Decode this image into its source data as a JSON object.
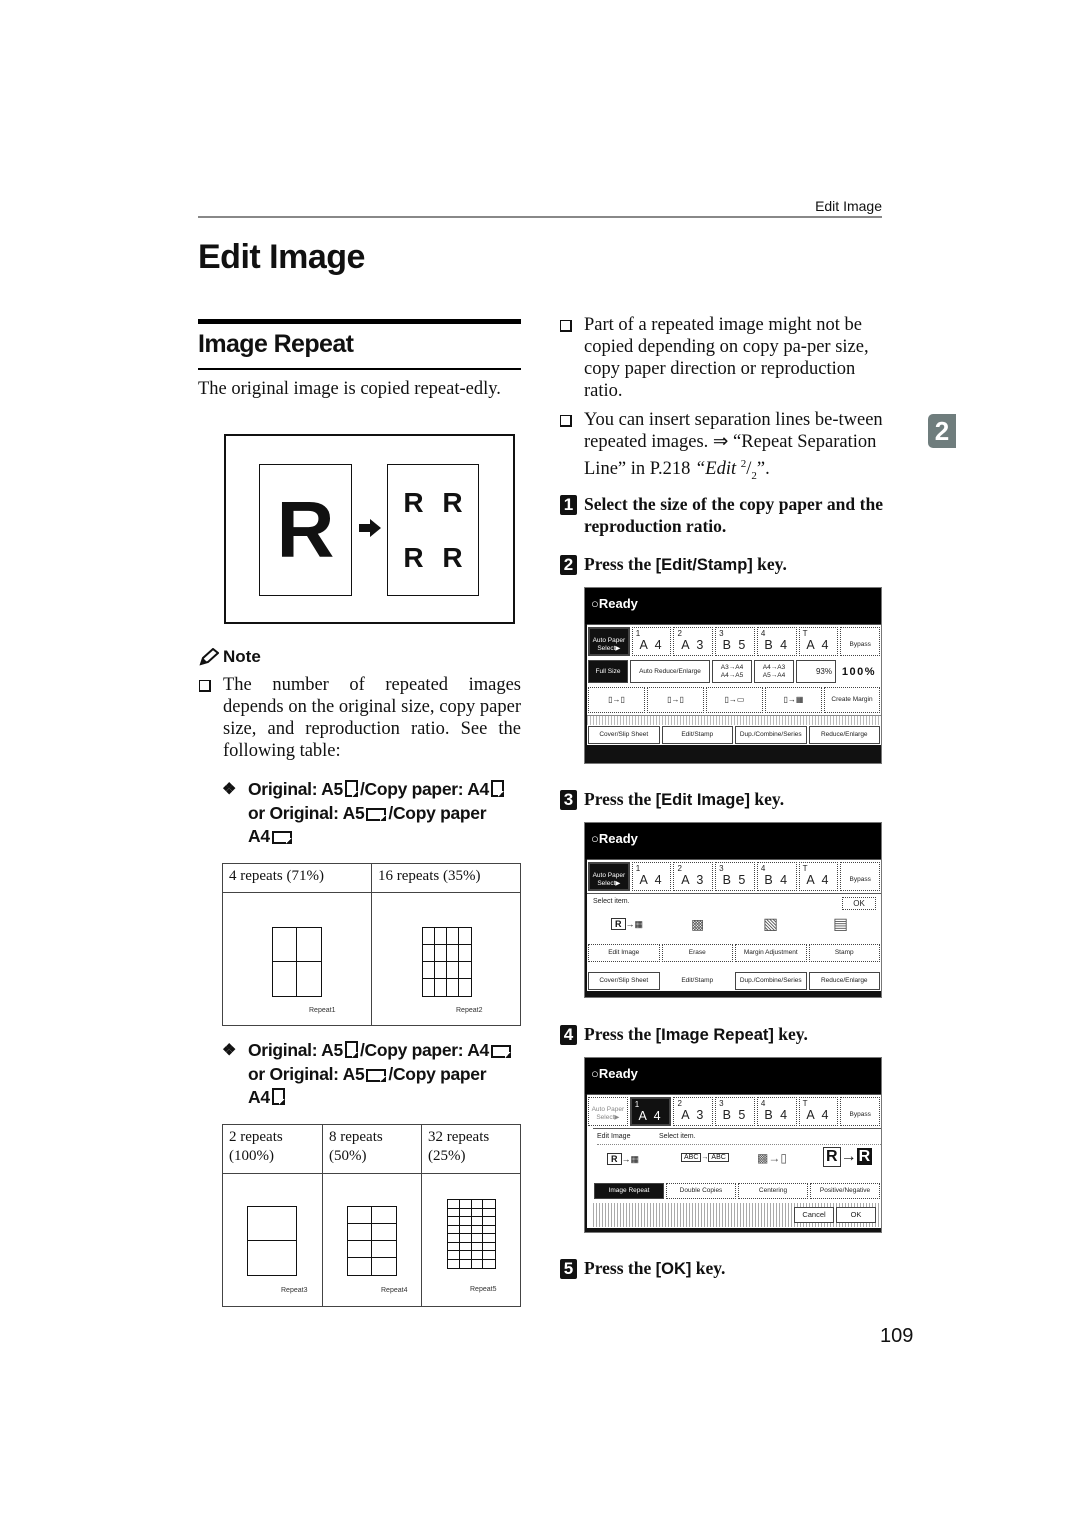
{
  "header": {
    "running_head": "Edit Image",
    "page_title": "Edit Image",
    "chapter_tab": "2",
    "page_number": "109"
  },
  "section": {
    "title": "Image Repeat",
    "intro": "The original image is copied repeat-edly.",
    "illustration": {
      "original_letter": "R",
      "copy_letters": [
        "R",
        "R",
        "R",
        "R"
      ]
    },
    "note": {
      "heading": "Note",
      "item": "The number of repeated images depends on the original size, copy paper size, and reproduction ratio. See the following table:"
    },
    "case1": {
      "heading_parts": [
        "Original: A5",
        "/Copy paper: A4",
        "or Original: A5",
        "/Copy paper",
        "A4"
      ],
      "columns": [
        {
          "label": "4 repeats (71%)",
          "figure_label": "Repeat1",
          "grid_cols": 2,
          "grid_rows": 2
        },
        {
          "label": "16 repeats (35%)",
          "figure_label": "Repeat2",
          "grid_cols": 4,
          "grid_rows": 4
        }
      ]
    },
    "case2": {
      "heading_parts": [
        "Original: A5",
        "/Copy paper: A4",
        "or Original: A5",
        "/Copy paper",
        "A4"
      ],
      "columns": [
        {
          "label_line1": "2 repeats",
          "label_line2": "(100%)",
          "figure_label": "Repeat3",
          "grid_cols": 1,
          "grid_rows": 2
        },
        {
          "label_line1": "8 repeats",
          "label_line2": "(50%)",
          "figure_label": "Repeat4",
          "grid_cols": 2,
          "grid_rows": 4
        },
        {
          "label_line1": "32 repeats",
          "label_line2": "(25%)",
          "figure_label": "Repeat5",
          "grid_cols": 4,
          "grid_rows": 8
        }
      ]
    }
  },
  "right": {
    "bullets": [
      "Part of a repeated image might not be copied depending on copy pa-per size, copy paper direction or reproduction ratio.",
      "You can insert separation lines be-tween repeated images. ⇒ “Repeat Separation Line” in P.218 "
    ],
    "bullet2_ref": "“Edit ",
    "bullet2_sup": "2",
    "bullet2_sub": "2",
    "bullet2_end": "”.",
    "steps": [
      {
        "num": "1",
        "text": "Select the size of the copy paper and the reproduction ratio."
      },
      {
        "num": "2",
        "pre": "Press the ",
        "key": "[Edit/Stamp]",
        "post": " key."
      },
      {
        "num": "3",
        "pre": "Press the ",
        "key": "[Edit Image]",
        "post": " key."
      },
      {
        "num": "4",
        "pre": "Press the ",
        "key": "[Image Repeat]",
        "post": " key."
      },
      {
        "num": "5",
        "pre": "Press the ",
        "key": "[OK]",
        "post": " key."
      }
    ]
  },
  "panel": {
    "status": "Ready",
    "auto_paper": "Auto Paper Select▶",
    "trays": [
      {
        "id": "1",
        "size": "A 4"
      },
      {
        "id": "2",
        "size": "A 3"
      },
      {
        "id": "3",
        "size": "B 5"
      },
      {
        "id": "4",
        "size": "B 4"
      },
      {
        "id": "T",
        "size": "A 4"
      }
    ],
    "bypass": "Bypass",
    "ratio_row": {
      "full_size": "Full Size",
      "auto_reduce": "Auto Reduce/Enlarge",
      "preset1": "A3→A4 A4→A5",
      "preset2": "A4→A3 A5→A4",
      "custom": "93%",
      "current": "100%"
    },
    "create_margin": "Create Margin",
    "tabs": [
      "Cover/Slip Sheet",
      "Edit/Stamp",
      "Dup./Combine/Series",
      "Reduce/Enlarge"
    ],
    "edit_menu": {
      "prompt": "Select item.",
      "ok": "OK",
      "items": [
        "Edit Image",
        "Erase",
        "Margin Adjustment",
        "Stamp"
      ]
    },
    "edit_image_menu": {
      "title": "Edit Image",
      "prompt": "Select item.",
      "items": [
        "Image Repeat",
        "Double Copies",
        "Centering",
        "Positive/Negative"
      ],
      "cancel": "Cancel",
      "ok": "OK"
    }
  }
}
